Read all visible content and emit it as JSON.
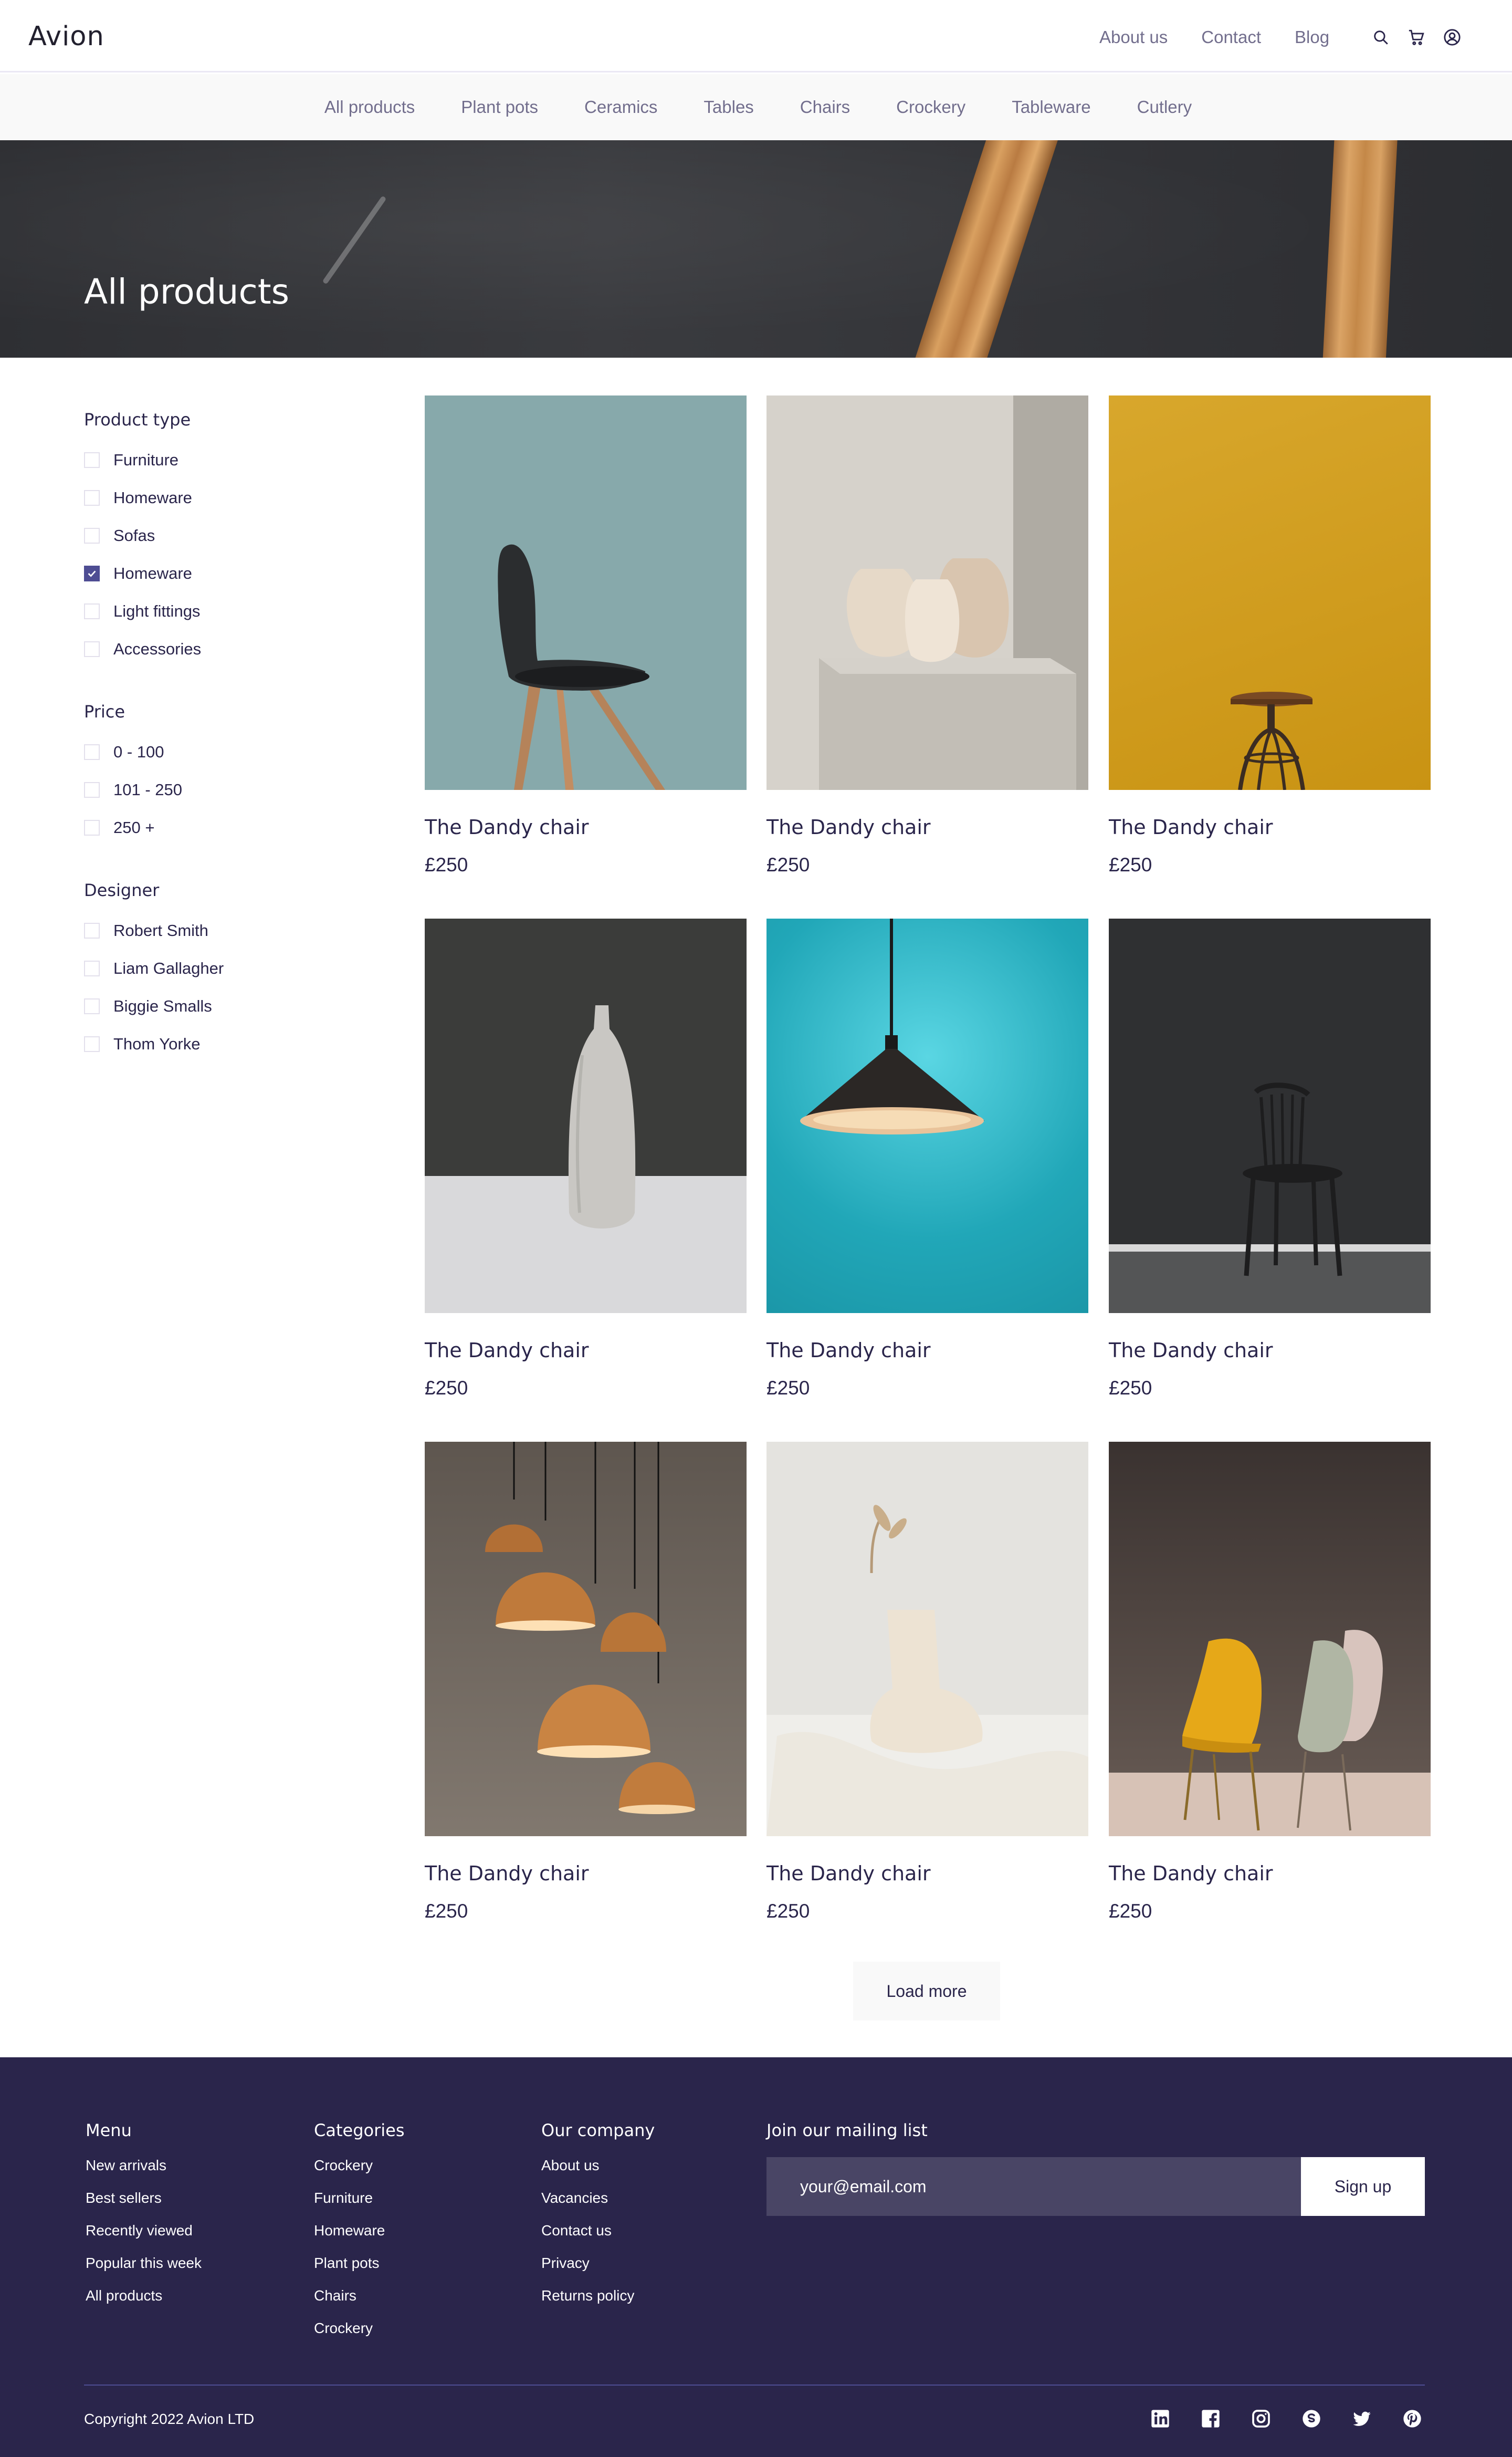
{
  "header": {
    "logo": "Avion",
    "nav": [
      "About us",
      "Contact",
      "Blog"
    ],
    "icons": [
      "search-icon",
      "cart-icon",
      "user-icon"
    ]
  },
  "categories": [
    "All products",
    "Plant pots",
    "Ceramics",
    "Tables",
    "Chairs",
    "Crockery",
    "Tableware",
    "Cutlery"
  ],
  "hero": {
    "title": "All products"
  },
  "filters": {
    "product_type": {
      "title": "Product type",
      "options": [
        {
          "label": "Furniture",
          "checked": false
        },
        {
          "label": "Homeware",
          "checked": false
        },
        {
          "label": "Sofas",
          "checked": false
        },
        {
          "label": "Homeware",
          "checked": true
        },
        {
          "label": "Light fittings",
          "checked": false
        },
        {
          "label": "Accessories",
          "checked": false
        }
      ]
    },
    "price": {
      "title": "Price",
      "options": [
        {
          "label": "0 - 100",
          "checked": false
        },
        {
          "label": "101 - 250",
          "checked": false
        },
        {
          "label": "250 +",
          "checked": false
        }
      ]
    },
    "designer": {
      "title": "Designer",
      "options": [
        {
          "label": "Robert Smith",
          "checked": false
        },
        {
          "label": "Liam Gallagher",
          "checked": false
        },
        {
          "label": "Biggie Smalls",
          "checked": false
        },
        {
          "label": "Thom Yorke",
          "checked": false
        }
      ]
    }
  },
  "products": [
    {
      "name": "The Dandy chair",
      "price": "£250",
      "image": "black-chair-teal"
    },
    {
      "name": "The Dandy chair",
      "price": "£250",
      "image": "ceramic-vases"
    },
    {
      "name": "The Dandy chair",
      "price": "£250",
      "image": "stool-yellow"
    },
    {
      "name": "The Dandy chair",
      "price": "£250",
      "image": "white-bottle-vase"
    },
    {
      "name": "The Dandy chair",
      "price": "£250",
      "image": "pendant-lamp-teal"
    },
    {
      "name": "The Dandy chair",
      "price": "£250",
      "image": "wooden-chair-grey"
    },
    {
      "name": "The Dandy chair",
      "price": "£250",
      "image": "copper-pendant-lamps"
    },
    {
      "name": "The Dandy chair",
      "price": "£250",
      "image": "cream-vase-dried-flower"
    },
    {
      "name": "The Dandy chair",
      "price": "£250",
      "image": "yellow-plastic-chairs"
    }
  ],
  "load_more": "Load more",
  "footer": {
    "columns": [
      {
        "title": "Menu",
        "links": [
          "New arrivals",
          "Best sellers",
          "Recently viewed",
          "Popular this week",
          "All products"
        ]
      },
      {
        "title": "Categories",
        "links": [
          "Crockery",
          "Furniture",
          "Homeware",
          "Plant pots",
          "Chairs",
          "Crockery"
        ]
      },
      {
        "title": "Our company",
        "links": [
          "About us",
          "Vacancies",
          "Contact us",
          "Privacy",
          "Returns policy"
        ]
      }
    ],
    "mailing": {
      "title": "Join our mailing list",
      "placeholder": "your@email.com",
      "button": "Sign up"
    },
    "copyright": "Copyright 2022 Avion LTD",
    "social_icons": [
      "linkedin-icon",
      "facebook-icon",
      "instagram-icon",
      "skype-icon",
      "twitter-icon",
      "pinterest-icon"
    ]
  },
  "colors": {
    "primary": "#2A254B",
    "accent": "#4E4D93",
    "nav_text": "#726E8D",
    "light_bg": "#F9F9F9"
  }
}
